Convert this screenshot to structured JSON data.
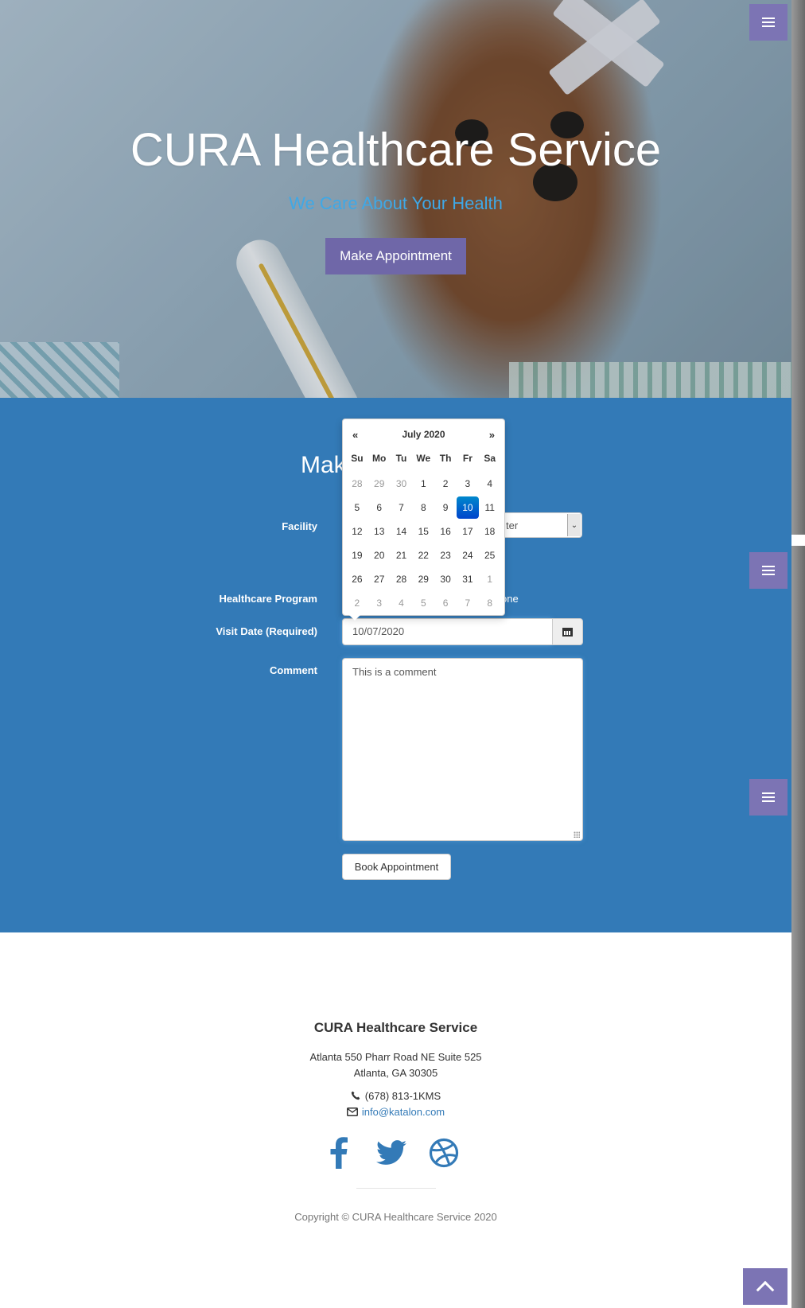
{
  "hero": {
    "title": "CURA Healthcare Service",
    "subtitle": "We Care About Your Health",
    "cta_label": "Make Appointment"
  },
  "appointment": {
    "heading_visible": "Mak",
    "facility_label": "Facility",
    "facility_value_visible": "ter",
    "program_label": "Healthcare Program",
    "program_option_visible": "one",
    "visit_date_label": "Visit Date (Required)",
    "visit_date_value": "10/07/2020",
    "comment_label": "Comment",
    "comment_value": "This is a comment",
    "book_label": "Book Appointment"
  },
  "datepicker": {
    "prev": "«",
    "next": "»",
    "month_title": "July 2020",
    "weekdays": [
      "Su",
      "Mo",
      "Tu",
      "We",
      "Th",
      "Fr",
      "Sa"
    ],
    "weeks": [
      [
        "28",
        "29",
        "30",
        "1",
        "2",
        "3",
        "4"
      ],
      [
        "5",
        "6",
        "7",
        "8",
        "9",
        "10",
        "11"
      ],
      [
        "12",
        "13",
        "14",
        "15",
        "16",
        "17",
        "18"
      ],
      [
        "19",
        "20",
        "21",
        "22",
        "23",
        "24",
        "25"
      ],
      [
        "26",
        "27",
        "28",
        "29",
        "30",
        "31",
        "1"
      ],
      [
        "2",
        "3",
        "4",
        "5",
        "6",
        "7",
        "8"
      ]
    ],
    "selected_day": "10"
  },
  "footer": {
    "title": "CURA Healthcare Service",
    "address_line1": "Atlanta 550 Pharr Road NE Suite 525",
    "address_line2": "Atlanta, GA 30305",
    "phone": "(678) 813-1KMS",
    "email": "info@katalon.com",
    "copyright": "Copyright © CURA Healthcare Service 2020"
  },
  "colors": {
    "section_blue": "#337ab7",
    "accent_purple": "#7c74b4",
    "subtitle_blue": "#3fa8e6",
    "social_blue": "#337ab7"
  },
  "icons": [
    "menu-icon",
    "calendar-icon",
    "phone-icon",
    "envelope-icon",
    "facebook-icon",
    "twitter-icon",
    "dribbble-icon",
    "chevron-up-icon"
  ]
}
